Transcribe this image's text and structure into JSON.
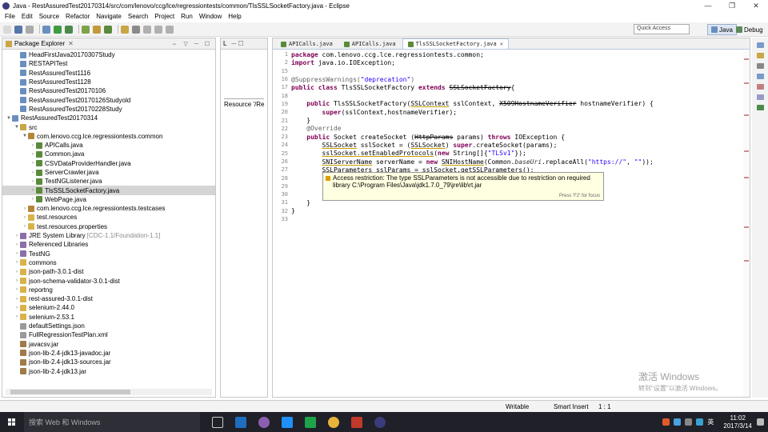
{
  "window": {
    "title": "Java - RestAssuredTest20170314/src/com/lenovo/ccg/lce/regressiontests/common/TlsSSLSocketFactory.java - Eclipse"
  },
  "menu": [
    "File",
    "Edit",
    "Source",
    "Refactor",
    "Navigate",
    "Search",
    "Project",
    "Run",
    "Window",
    "Help"
  ],
  "toolbar": {
    "quick_access": "Quick Access",
    "perspective_java": "Java",
    "perspective_debug": "Debug"
  },
  "package_explorer": {
    "tab_label": "Package Explorer",
    "items": [
      {
        "label": "HeadFirstJava20170307Study",
        "indent": 1,
        "arrow": "",
        "icon": "project"
      },
      {
        "label": "RESTAPITest",
        "indent": 1,
        "arrow": "",
        "icon": "project"
      },
      {
        "label": "RestAssuredTest1116",
        "indent": 1,
        "arrow": "",
        "icon": "project"
      },
      {
        "label": "RestAssuredTest1128",
        "indent": 1,
        "arrow": "",
        "icon": "project"
      },
      {
        "label": "RestAssuredTest20170106",
        "indent": 1,
        "arrow": "",
        "icon": "project"
      },
      {
        "label": "RestAssuredTest20170126Studyold",
        "indent": 1,
        "arrow": "",
        "icon": "project"
      },
      {
        "label": "RestAssuredTest20170228Study",
        "indent": 1,
        "arrow": "",
        "icon": "project"
      },
      {
        "label": "RestAssuredTest20170314",
        "indent": 0,
        "arrow": "▼",
        "icon": "project"
      },
      {
        "label": "src",
        "indent": 1,
        "arrow": "▼",
        "icon": "src"
      },
      {
        "label": "com.lenovo.ccg.lce.regressiontests.common",
        "indent": 2,
        "arrow": "▼",
        "icon": "package"
      },
      {
        "label": "APICalls.java",
        "indent": 3,
        "arrow": "›",
        "icon": "java"
      },
      {
        "label": "Common.java",
        "indent": 3,
        "arrow": "›",
        "icon": "java"
      },
      {
        "label": "CSVDataProviderHandler.java",
        "indent": 3,
        "arrow": "›",
        "icon": "java"
      },
      {
        "label": "ServerCrawler.java",
        "indent": 3,
        "arrow": "›",
        "icon": "java"
      },
      {
        "label": "TestNGListener.java",
        "indent": 3,
        "arrow": "›",
        "icon": "java"
      },
      {
        "label": "TlsSSLSocketFactory.java",
        "indent": 3,
        "arrow": "›",
        "icon": "java",
        "selected": true
      },
      {
        "label": "WebPage.java",
        "indent": 3,
        "arrow": "›",
        "icon": "java"
      },
      {
        "label": "com.lenovo.ccg.lce.regressiontests.testcases",
        "indent": 2,
        "arrow": "›",
        "icon": "package"
      },
      {
        "label": "test.resources",
        "indent": 2,
        "arrow": "›",
        "icon": "folder"
      },
      {
        "label": "test.resources.properties",
        "indent": 2,
        "arrow": "›",
        "icon": "folder"
      },
      {
        "label": "JRE System Library",
        "suffix": "[CDC-1.1/Foundation-1.1]",
        "indent": 1,
        "arrow": "›",
        "icon": "lib"
      },
      {
        "label": "Referenced Libraries",
        "indent": 1,
        "arrow": "›",
        "icon": "lib"
      },
      {
        "label": "TestNG",
        "indent": 1,
        "arrow": "›",
        "icon": "lib"
      },
      {
        "label": "commons",
        "indent": 1,
        "arrow": "›",
        "icon": "folder"
      },
      {
        "label": "json-path-3.0.1-dist",
        "indent": 1,
        "arrow": "›",
        "icon": "folder"
      },
      {
        "label": "json-schema-validator-3.0.1-dist",
        "indent": 1,
        "arrow": "›",
        "icon": "folder"
      },
      {
        "label": "reportng",
        "indent": 1,
        "arrow": "›",
        "icon": "folder"
      },
      {
        "label": "rest-assured-3.0.1-dist",
        "indent": 1,
        "arrow": "›",
        "icon": "folder"
      },
      {
        "label": "selenium-2.44.0",
        "indent": 1,
        "arrow": "›",
        "icon": "folder"
      },
      {
        "label": "selenium-2.53.1",
        "indent": 1,
        "arrow": "›",
        "icon": "folder"
      },
      {
        "label": "defaultSettings.json",
        "indent": 1,
        "arrow": "",
        "icon": "file"
      },
      {
        "label": "FullRegressionTestPlan.xml",
        "indent": 1,
        "arrow": "",
        "icon": "file"
      },
      {
        "label": "javacsv.jar",
        "indent": 1,
        "arrow": "",
        "icon": "jar"
      },
      {
        "label": "json-lib-2.4-jdk13-javadoc.jar",
        "indent": 1,
        "arrow": "",
        "icon": "jar"
      },
      {
        "label": "json-lib-2.4-jdk13-sources.jar",
        "indent": 1,
        "arrow": "",
        "icon": "jar"
      },
      {
        "label": "json-lib-2.4-jdk13.jar",
        "indent": 1,
        "arrow": "",
        "icon": "jar"
      }
    ]
  },
  "middle_view": {
    "tab1": "L",
    "resource_label": "Resource '/Re"
  },
  "editor": {
    "tabs": [
      {
        "label": "APICalls.java",
        "active": false
      },
      {
        "label": "APICalls.java",
        "active": false
      },
      {
        "label": "TlsSSLSocketFactory.java",
        "active": true
      }
    ],
    "line_numbers": [
      "1",
      "2",
      "15",
      "16",
      "17",
      "18",
      "19",
      "20",
      "21",
      "22",
      "23",
      "24",
      "25",
      "26",
      "27",
      "28",
      "29",
      "30",
      "31",
      "32",
      "33"
    ],
    "tooltip": {
      "line1": "Access restriction: The type SSLParameters is not accessible due to restriction on required",
      "line2": "library C:\\Program Files\\Java\\jdk1.7.0_79\\jre\\lib\\rt.jar",
      "focus_hint": "Press 'F2' for focus"
    }
  },
  "status_bar": {
    "mode": "Writable",
    "insert": "Smart Insert",
    "position": "1 : 1"
  },
  "watermark": {
    "line1": "激活 Windows",
    "line2": "转到\"设置\"以激活 Windows。"
  },
  "taskbar": {
    "search": "搜索 Web 和 Windows",
    "ime": "英",
    "time": "11:02",
    "date": "2017/3/14"
  }
}
